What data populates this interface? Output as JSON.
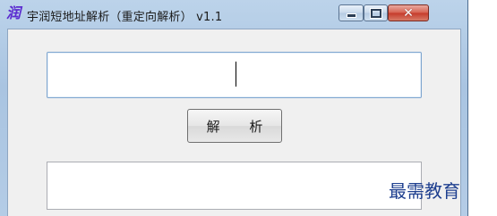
{
  "window": {
    "title": "宇润短地址解析（重定向解析） v1.1",
    "icon_glyph": "润"
  },
  "controls": {
    "minimize_icon": "minimize-icon",
    "maximize_icon": "maximize-icon",
    "close_glyph": "✕"
  },
  "main": {
    "url_input_value": "",
    "url_input_placeholder": "",
    "parse_button_label": "解 析",
    "result_value": ""
  },
  "watermark": "最需教育",
  "colors": {
    "accent": "#7fa6cf",
    "close": "#c5392a",
    "watermark": "#1e3f8f"
  }
}
